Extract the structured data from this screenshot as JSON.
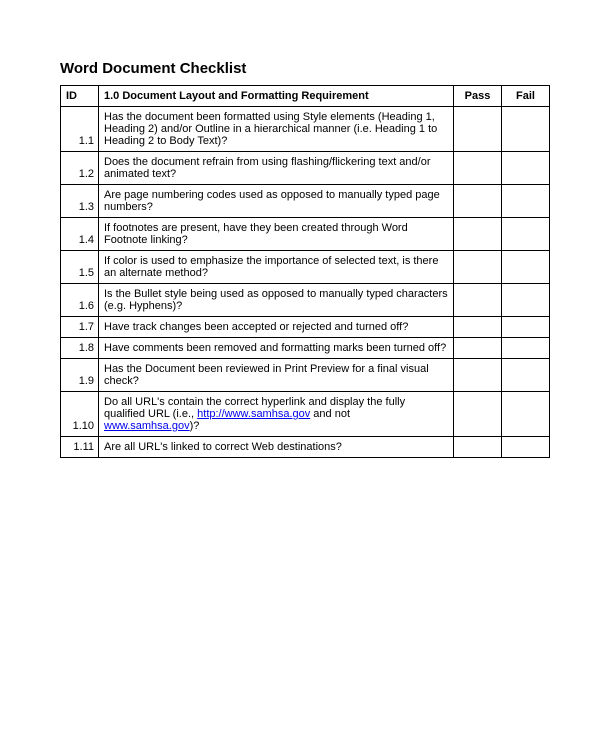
{
  "title": "Word Document Checklist",
  "headers": {
    "id": "ID",
    "desc": "1.0 Document Layout and Formatting Requirement",
    "pass": "Pass",
    "fail": "Fail"
  },
  "rows": [
    {
      "id": "1.1",
      "desc": "Has the document been formatted using Style elements (Heading 1, Heading 2) and/or Outline in a hierarchical manner (i.e. Heading 1 to Heading 2 to Body Text)?"
    },
    {
      "id": "1.2",
      "desc": "Does the document refrain from using flashing/flickering text and/or animated text?"
    },
    {
      "id": "1.3",
      "desc": "Are page numbering codes used as opposed to manually typed page numbers?"
    },
    {
      "id": "1.4",
      "desc": "If footnotes are present, have they been created through Word Footnote linking?"
    },
    {
      "id": "1.5",
      "desc": "If color is used to emphasize the importance of selected text, is there an alternate method?"
    },
    {
      "id": "1.6",
      "desc": "Is the Bullet style being used as opposed to manually typed characters (e.g. Hyphens)?"
    },
    {
      "id": "1.7",
      "desc": "Have track changes been accepted or rejected and turned off?"
    },
    {
      "id": "1.8",
      "desc": "Have comments been removed and formatting marks been turned off?"
    },
    {
      "id": "1.9",
      "desc": "Has the Document been reviewed in Print Preview for a final visual check?"
    },
    {
      "id": "1.10",
      "desc_parts": {
        "before": "Do all URL's contain the correct hyperlink and display the fully qualified URL (i.e., ",
        "link1_text": "http://www.samhsa.gov",
        "middle": " and not ",
        "link2_text": "www.samhsa.gov",
        "after": ")?"
      }
    },
    {
      "id": "1.11",
      "desc": "Are all URL's linked to correct Web destinations?"
    }
  ]
}
